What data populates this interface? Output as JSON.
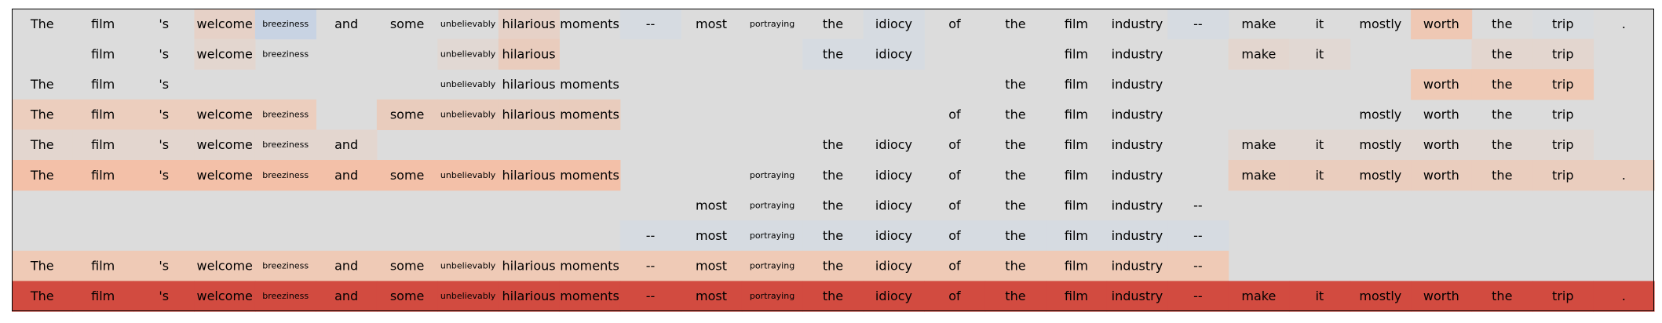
{
  "chart_data": {
    "type": "heatmap",
    "tokens": [
      "The",
      "film",
      "'s",
      "welcome",
      "breeziness",
      "and",
      "some",
      "unbelievably",
      "hilarious",
      "moments",
      "--",
      "most",
      "portraying",
      "the",
      "idiocy",
      "of",
      "the",
      "film",
      "industry",
      "--",
      "make",
      "it",
      "mostly",
      "worth",
      "the",
      "trip",
      "."
    ],
    "masks": [
      [
        1,
        1,
        1,
        1,
        1,
        1,
        1,
        1,
        1,
        1,
        1,
        1,
        1,
        1,
        1,
        1,
        1,
        1,
        1,
        1,
        1,
        1,
        1,
        1,
        1,
        1,
        1
      ],
      [
        0,
        1,
        1,
        1,
        1,
        0,
        0,
        1,
        1,
        0,
        0,
        0,
        0,
        1,
        1,
        0,
        0,
        1,
        1,
        0,
        1,
        1,
        0,
        0,
        1,
        1,
        0
      ],
      [
        1,
        1,
        1,
        0,
        0,
        0,
        0,
        1,
        1,
        1,
        0,
        0,
        0,
        0,
        0,
        0,
        1,
        1,
        1,
        0,
        0,
        0,
        0,
        1,
        1,
        1,
        0
      ],
      [
        1,
        1,
        1,
        1,
        1,
        0,
        1,
        1,
        1,
        1,
        0,
        0,
        0,
        0,
        0,
        1,
        1,
        1,
        1,
        0,
        0,
        0,
        1,
        1,
        1,
        1,
        0
      ],
      [
        1,
        1,
        1,
        1,
        1,
        1,
        0,
        0,
        0,
        0,
        0,
        0,
        0,
        1,
        1,
        1,
        1,
        1,
        1,
        0,
        1,
        1,
        1,
        1,
        1,
        1,
        0
      ],
      [
        1,
        1,
        1,
        1,
        1,
        1,
        1,
        1,
        1,
        1,
        0,
        0,
        1,
        1,
        1,
        1,
        1,
        1,
        1,
        0,
        1,
        1,
        1,
        1,
        1,
        1,
        1
      ],
      [
        0,
        0,
        0,
        0,
        0,
        0,
        0,
        0,
        0,
        0,
        0,
        1,
        1,
        1,
        1,
        1,
        1,
        1,
        1,
        1,
        0,
        0,
        0,
        0,
        0,
        0,
        0
      ],
      [
        0,
        0,
        0,
        0,
        0,
        0,
        0,
        0,
        0,
        0,
        1,
        1,
        1,
        1,
        1,
        1,
        1,
        1,
        1,
        1,
        0,
        0,
        0,
        0,
        0,
        0,
        0
      ],
      [
        1,
        1,
        1,
        1,
        1,
        1,
        1,
        1,
        1,
        1,
        1,
        1,
        1,
        1,
        1,
        1,
        1,
        1,
        1,
        1,
        0,
        0,
        0,
        0,
        0,
        0,
        0
      ],
      [
        1,
        1,
        1,
        1,
        1,
        1,
        1,
        1,
        1,
        1,
        1,
        1,
        1,
        1,
        1,
        1,
        1,
        1,
        1,
        1,
        1,
        1,
        1,
        1,
        1,
        1,
        1
      ]
    ],
    "cell_colors": [
      [
        "#dcdcdc",
        "#dcdcdc",
        "#dcdcdc",
        "#e6d1c7",
        "#c8d3e3",
        "#dcdcdc",
        "#dcdcdc",
        "#dcdcdc",
        "#e6d1c7",
        "#dcdcdc",
        "#d6dbe1",
        "#dcdcdc",
        "#dcdcdc",
        "#dcdcdc",
        "#d6dbe1",
        "#dcdcdc",
        "#dcdcdc",
        "#dcdcdc",
        "#dcdcdc",
        "#d6dbe1",
        "#dcdcdc",
        "#dcdcdc",
        "#dcdcdc",
        "#efc8b4",
        "#dcdcdc",
        "#d9dcdf",
        "#dcdcdc"
      ],
      [
        "#dcdcdc",
        "#dcdcdc",
        "#dcdcdc",
        "#e3d6cf",
        "#dcdcdc",
        "#dcdcdc",
        "#dcdcdc",
        "#e1d8d3",
        "#e9ccbd",
        "#dcdcdc",
        "#dcdcdc",
        "#dcdcdc",
        "#dcdcdc",
        "#d6dbe1",
        "#d6dbe1",
        "#dcdcdc",
        "#dcdcdc",
        "#dcdcdc",
        "#dcdcdc",
        "#dcdcdc",
        "#e3d6cf",
        "#e1d8d3",
        "#dcdcdc",
        "#dcdcdc",
        "#e3d6cf",
        "#e3d6cf",
        "#dcdcdc"
      ],
      [
        "#dcdcdc",
        "#dcdcdc",
        "#dcdcdc",
        "#dcdcdc",
        "#dcdcdc",
        "#dcdcdc",
        "#dcdcdc",
        "#dcdcdc",
        "#dcdcdc",
        "#dcdcdc",
        "#dcdcdc",
        "#dcdcdc",
        "#dcdcdc",
        "#dcdcdc",
        "#dcdcdc",
        "#dcdcdc",
        "#dcdcdc",
        "#dcdcdc",
        "#dcdcdc",
        "#dcdcdc",
        "#dcdcdc",
        "#dcdcdc",
        "#dcdcdc",
        "#efcab6",
        "#efcab6",
        "#efcab6",
        "#dcdcdc"
      ],
      [
        "#eccebe",
        "#eccebe",
        "#eccebe",
        "#eccebe",
        "#eccebe",
        "#dcdcdc",
        "#e9ccbd",
        "#e9ccbd",
        "#e9ccbd",
        "#e9ccbd",
        "#dcdcdc",
        "#dcdcdc",
        "#dcdcdc",
        "#dcdcdc",
        "#dcdcdc",
        "#dcdcdc",
        "#dcdcdc",
        "#dcdcdc",
        "#dcdcdc",
        "#dcdcdc",
        "#dcdcdc",
        "#dcdcdc",
        "#dcdcdc",
        "#dcdcdc",
        "#dcdcdc",
        "#dcdcdc",
        "#dcdcdc"
      ],
      [
        "#e3d6cf",
        "#e3d6cf",
        "#e3d6cf",
        "#e3d6cf",
        "#e3d6cf",
        "#e3d6cf",
        "#dcdcdc",
        "#dcdcdc",
        "#dcdcdc",
        "#dcdcdc",
        "#dcdcdc",
        "#dcdcdc",
        "#dcdcdc",
        "#dcdcdc",
        "#dcdcdc",
        "#dcdcdc",
        "#dcdcdc",
        "#dcdcdc",
        "#dcdcdc",
        "#dcdcdc",
        "#e1d8d3",
        "#e1d8d3",
        "#e1d8d3",
        "#e1d8d3",
        "#e1d8d3",
        "#e1d8d3",
        "#dcdcdc"
      ],
      [
        "#f3c0a8",
        "#f3c0a8",
        "#f3c0a8",
        "#f3c0a8",
        "#f3c0a8",
        "#f3c0a8",
        "#f3c0a8",
        "#f3c0a8",
        "#f3c0a8",
        "#f3c0a8",
        "#dcdcdc",
        "#dcdcdc",
        "#dcdcdc",
        "#dcdcdc",
        "#dcdcdc",
        "#dcdcdc",
        "#dcdcdc",
        "#dcdcdc",
        "#dcdcdc",
        "#dcdcdc",
        "#eacdbe",
        "#eacdbe",
        "#eacdbe",
        "#eacdbe",
        "#eacdbe",
        "#eacdbe",
        "#eacdbe"
      ],
      [
        "#dcdcdc",
        "#dcdcdc",
        "#dcdcdc",
        "#dcdcdc",
        "#dcdcdc",
        "#dcdcdc",
        "#dcdcdc",
        "#dcdcdc",
        "#dcdcdc",
        "#dcdcdc",
        "#dcdcdc",
        "#dcdcdc",
        "#dcdcdc",
        "#dcdcdc",
        "#dcdcdc",
        "#dcdcdc",
        "#dcdcdc",
        "#dcdcdc",
        "#dcdcdc",
        "#dcdcdc",
        "#dcdcdc",
        "#dcdcdc",
        "#dcdcdc",
        "#dcdcdc",
        "#dcdcdc",
        "#dcdcdc",
        "#dcdcdc"
      ],
      [
        "#dcdcdc",
        "#dcdcdc",
        "#dcdcdc",
        "#dcdcdc",
        "#dcdcdc",
        "#dcdcdc",
        "#dcdcdc",
        "#dcdcdc",
        "#dcdcdc",
        "#dcdcdc",
        "#d6dbe1",
        "#d6dbe1",
        "#d6dbe1",
        "#d6dbe1",
        "#d6dbe1",
        "#d6dbe1",
        "#d6dbe1",
        "#d6dbe1",
        "#d6dbe1",
        "#d6dbe1",
        "#dcdcdc",
        "#dcdcdc",
        "#dcdcdc",
        "#dcdcdc",
        "#dcdcdc",
        "#dcdcdc",
        "#dcdcdc"
      ],
      [
        "#efcab6",
        "#efcab6",
        "#efcab6",
        "#efcab6",
        "#efcab6",
        "#efcab6",
        "#efcab6",
        "#efcab6",
        "#efcab6",
        "#efcab6",
        "#efcab6",
        "#efcab6",
        "#efcab6",
        "#efcab6",
        "#efcab6",
        "#efcab6",
        "#efcab6",
        "#efcab6",
        "#efcab6",
        "#efcab6",
        "#dcdcdc",
        "#dcdcdc",
        "#dcdcdc",
        "#dcdcdc",
        "#dcdcdc",
        "#dcdcdc",
        "#dcdcdc"
      ],
      [
        "#d24b40",
        "#d24b40",
        "#d24b40",
        "#d24b40",
        "#d24b40",
        "#d24b40",
        "#d24b40",
        "#d24b40",
        "#d24b40",
        "#d24b40",
        "#d24b40",
        "#d24b40",
        "#d24b40",
        "#d24b40",
        "#d24b40",
        "#d24b40",
        "#d24b40",
        "#d24b40",
        "#d24b40",
        "#d24b40",
        "#d24b40",
        "#d24b40",
        "#d24b40",
        "#d24b40",
        "#d24b40",
        "#d24b40",
        "#d24b40"
      ]
    ],
    "background_color": "#dcdcdc",
    "border_color": "#000000",
    "small_font_tokens": [
      "breeziness",
      "unbelievably",
      "portraying"
    ]
  }
}
